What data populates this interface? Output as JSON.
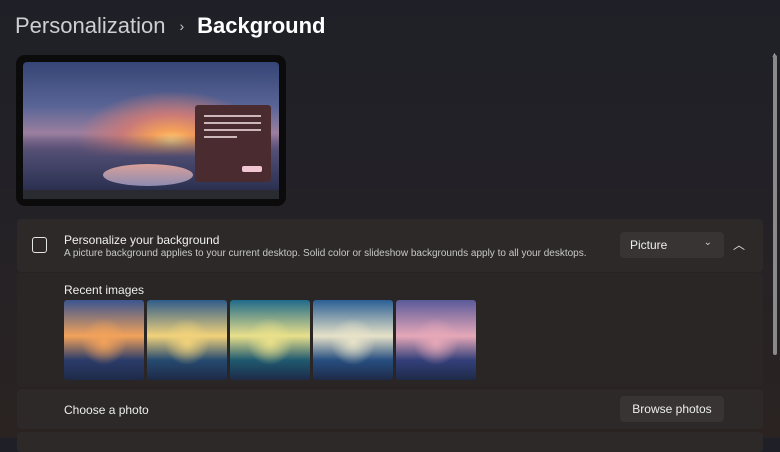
{
  "breadcrumb": {
    "parent": "Personalization",
    "separator": "›",
    "current": "Background"
  },
  "personalize": {
    "title": "Personalize your background",
    "description": "A picture background applies to your current desktop. Solid color or slideshow backgrounds apply to all your desktops.",
    "dropdown_value": "Picture"
  },
  "recent": {
    "label": "Recent images",
    "thumbnails": [
      {
        "top": "#3a5590",
        "mid": "#f2a25a",
        "bottom": "#2b3c6a"
      },
      {
        "top": "#2f5c8a",
        "mid": "#f1d27a",
        "bottom": "#264a70"
      },
      {
        "top": "#1f6a8a",
        "mid": "#e9e08a",
        "bottom": "#1f5a70"
      },
      {
        "top": "#2a5f95",
        "mid": "#e7e2c8",
        "bottom": "#274f80"
      },
      {
        "top": "#5a5a9a",
        "mid": "#e6a8b8",
        "bottom": "#34407a"
      }
    ]
  },
  "choose": {
    "label": "Choose a photo",
    "button": "Browse photos"
  }
}
